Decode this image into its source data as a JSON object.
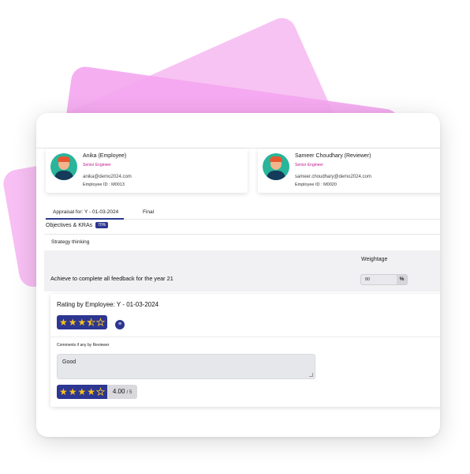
{
  "employee": {
    "name": "Anika (Employee)",
    "role": "Senior Engineer",
    "email": "anika@demo2024.com",
    "id": "Employee ID : M0013"
  },
  "reviewer": {
    "name": "Sameer Choudhary (Reviewer)",
    "role": "Senior Engineer",
    "email": "sameer.choudhary@demo2024.com",
    "id": "Employee ID : M0020"
  },
  "tabs": [
    {
      "label": "Appraisal for: Y - 01-03-2024",
      "active": true
    },
    {
      "label": "Final",
      "active": false
    }
  ],
  "objectives": {
    "title": "Objectives & KRAs",
    "badge": "70%"
  },
  "kra": {
    "category": "Strategy thinking",
    "weightage_label": "Weightage",
    "text": "Achieve to complete all feedback for the year 21",
    "weightage_value": "80",
    "weightage_unit": "%"
  },
  "employee_rating": {
    "title": "Rating by Employee: Y - 01-03-2024",
    "stars": 3.5,
    "max": 5,
    "comment_icon": "comment-icon"
  },
  "reviewer_comments": {
    "label": "Comments if any by Reviewer",
    "text": "Good"
  },
  "final_rating": {
    "stars": 4,
    "max": 5,
    "value": "4.00",
    "out_of": "/ 5"
  },
  "colors": {
    "accent": "#2d3690",
    "role_text": "#c2188f",
    "star": "#f7c31c",
    "background_cards": "#f4a6ef"
  }
}
